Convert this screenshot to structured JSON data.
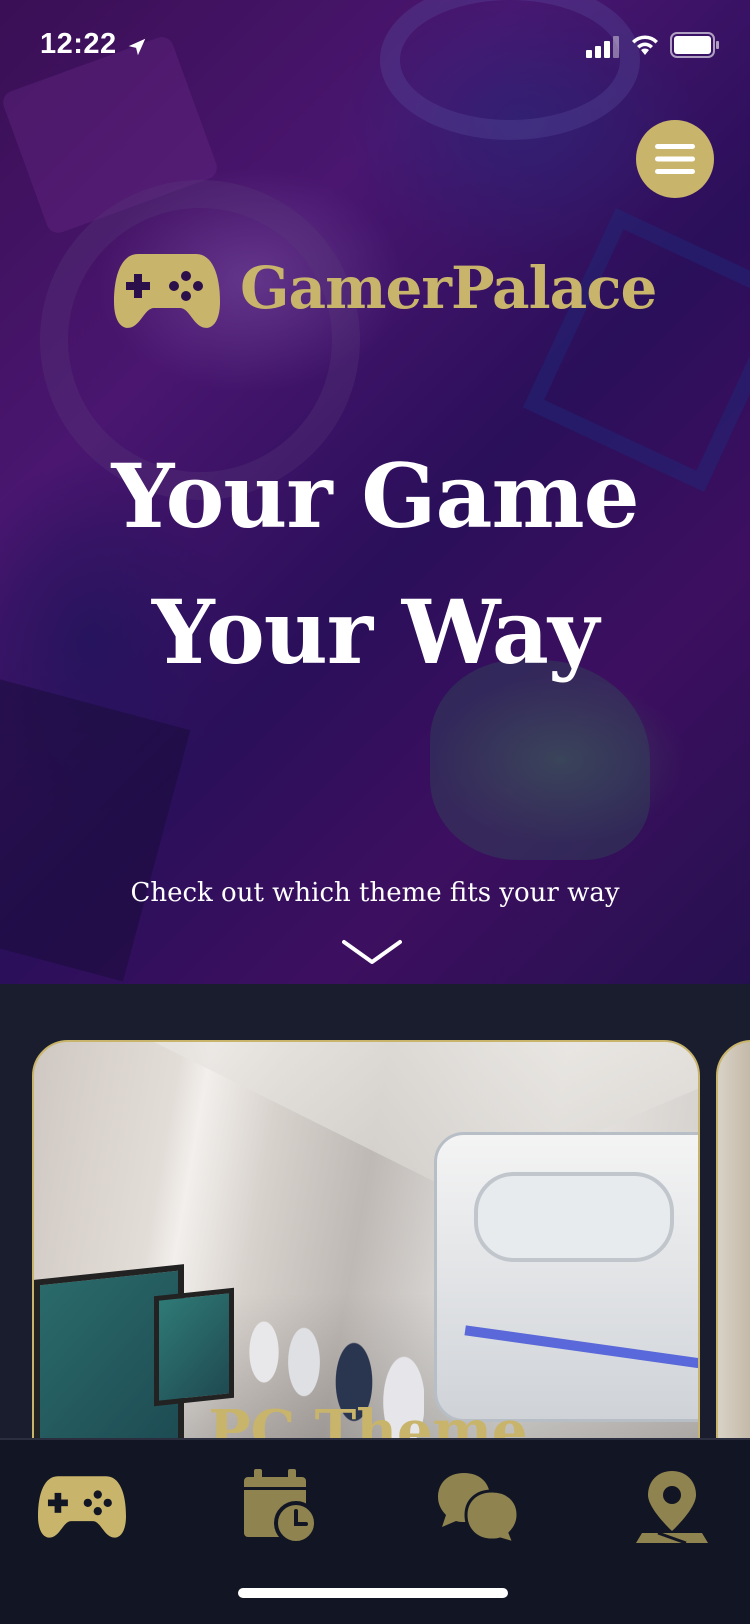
{
  "status_bar": {
    "time": "12:22"
  },
  "header": {
    "menu_icon": "hamburger-menu-icon"
  },
  "brand": {
    "name": "GamerPalace",
    "icon": "gamepad-icon",
    "color": "#c9b46b"
  },
  "hero": {
    "headline_line1": "Your Game",
    "headline_line2": "Your Way",
    "subline": "Check out which theme fits your way",
    "scroll_icon": "chevron-down-icon"
  },
  "cards": [
    {
      "title": "PC Theme"
    }
  ],
  "tabbar": {
    "items": [
      {
        "icon": "gamepad-icon"
      },
      {
        "icon": "calendar-clock-icon"
      },
      {
        "icon": "chat-bubbles-icon"
      },
      {
        "icon": "map-pin-icon"
      }
    ]
  },
  "colors": {
    "accent": "#c9b46b",
    "background": "#1a1d2e",
    "tabbar": "#121624"
  }
}
